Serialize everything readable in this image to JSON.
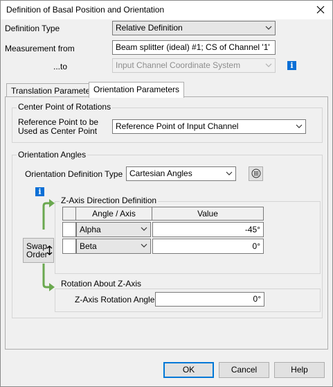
{
  "window": {
    "title": "Definition of Basal Position and Orientation"
  },
  "form": {
    "definition_type_label": "Definition Type",
    "definition_type_value": "Relative Definition",
    "measurement_from_label": "Measurement from",
    "measurement_from_value": "Beam splitter (ideal) #1; CS of Channel '1'",
    "to_label": "...to",
    "to_value": "Input Channel Coordinate System"
  },
  "tabs": [
    {
      "label": "Translation Parameters",
      "active": false
    },
    {
      "label": "Orientation Parameters",
      "active": true
    }
  ],
  "center_point": {
    "group_title": "Center Point of Rotations",
    "label_line1": "Reference Point to be",
    "label_line2": "Used as Center Point",
    "value": "Reference Point of Input Channel"
  },
  "orientation": {
    "group_title": "Orientation Angles",
    "def_type_label": "Orientation Definition Type",
    "def_type_value": "Cartesian Angles",
    "z_axis_group_title": "Z-Axis Direction Definition",
    "table_headers": [
      "Angle / Axis",
      "Value"
    ],
    "rows": [
      {
        "axis": "Alpha",
        "value": "-45°"
      },
      {
        "axis": "Beta",
        "value": "0°"
      }
    ],
    "swap_label_line1": "Swap",
    "swap_label_line2": "Order",
    "rotation_group_title": "Rotation About Z-Axis",
    "rotation_label": "Z-Axis Rotation Angle",
    "rotation_value": "0°"
  },
  "buttons": {
    "ok": "OK",
    "cancel": "Cancel",
    "help": "Help"
  },
  "colors": {
    "info_icon": "#0a6fd6",
    "arrow_green": "#6aa84f",
    "default_button_border": "#0078d7"
  }
}
